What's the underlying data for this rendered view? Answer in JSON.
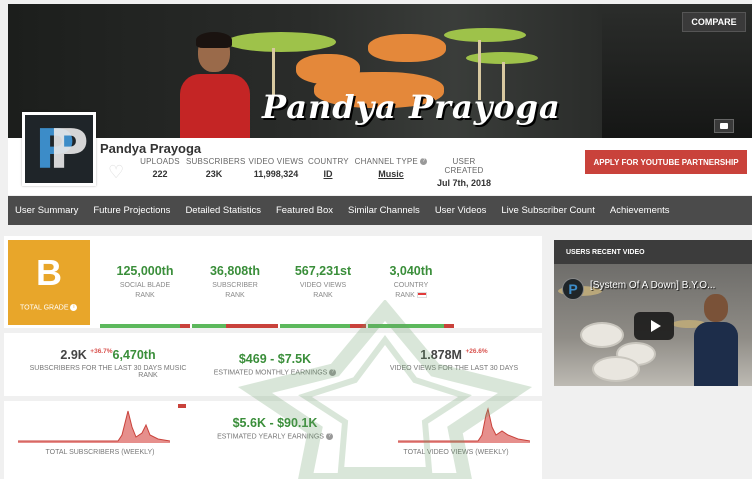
{
  "banner": {
    "title": "Pandya Prayoga",
    "compare_label": "COMPARE"
  },
  "channel": {
    "name": "Pandya Prayoga",
    "avatar_letters": "PP"
  },
  "stats": {
    "uploads_label": "UPLOADS",
    "uploads": "222",
    "subscribers_label": "SUBSCRIBERS",
    "subscribers": "23K",
    "views_label": "VIDEO VIEWS",
    "views": "11,998,324",
    "country_label": "COUNTRY",
    "country": "ID",
    "type_label": "CHANNEL TYPE",
    "type": "Music",
    "created_label": "USER CREATED",
    "created": "Jul 7th, 2018"
  },
  "apply_label": "APPLY FOR YOUTUBE PARTNERSHIP",
  "nav": [
    "User Summary",
    "Future Projections",
    "Detailed Statistics",
    "Featured Box",
    "Similar Channels",
    "User Videos",
    "Live Subscriber Count",
    "Achievements"
  ],
  "grade": {
    "letter": "B",
    "label": "TOTAL GRADE"
  },
  "ranks": [
    {
      "num": "125,000th",
      "sub1": "SOCIAL BLADE",
      "sub2": "RANK"
    },
    {
      "num": "36,808th",
      "sub1": "SUBSCRIBER",
      "sub2": "RANK"
    },
    {
      "num": "567,231st",
      "sub1": "VIDEO VIEWS",
      "sub2": "RANK"
    },
    {
      "num": "3,040th",
      "sub1": "COUNTRY",
      "sub2": "RANK"
    }
  ],
  "row2": {
    "subs30": "2.9K",
    "subs30_delta": "+36.7%",
    "music_rank": "6,470th",
    "subs30_label": "SUBSCRIBERS FOR THE LAST 30 DAYS",
    "music_label": "MUSIC",
    "music_label2": "RANK",
    "monthly": "$469  -  $7.5K",
    "monthly_label": "ESTIMATED MONTHLY EARNINGS",
    "views30": "1.878M",
    "views30_delta": "+26.6%",
    "views30_label": "VIDEO VIEWS FOR THE LAST 30 DAYS"
  },
  "row3": {
    "yearly": "$5.6K  -  $90.1K",
    "yearly_label": "ESTIMATED YEARLY EARNINGS",
    "subs_weekly_label": "TOTAL SUBSCRIBERS (WEEKLY)",
    "views_weekly_label": "TOTAL VIDEO VIEWS (WEEKLY)"
  },
  "recent_video": {
    "header": "USERS RECENT VIDEO",
    "title": "[System Of A Down] B.Y.O..."
  },
  "colors": {
    "green": "#3a8e3a",
    "red": "#c9423b",
    "grade": "#e8a62a",
    "nav": "#4b4b4b"
  }
}
